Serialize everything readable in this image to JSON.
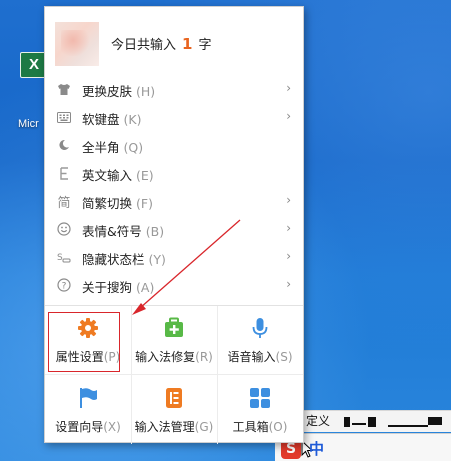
{
  "desktop": {
    "icon_label": "Micr",
    "status_text": "定义",
    "ime_logo": "S",
    "ime_mode": "中"
  },
  "menu": {
    "header": {
      "prefix": "今日共输入",
      "count": "1",
      "suffix": "字"
    },
    "items": [
      {
        "label": "更换皮肤",
        "hotkey": "(H)",
        "icon": "shirt-icon",
        "submenu": true
      },
      {
        "label": "软键盘",
        "hotkey": "(K)",
        "icon": "keyboard-icon",
        "submenu": true
      },
      {
        "label": "全半角",
        "hotkey": "(Q)",
        "icon": "moon-icon",
        "submenu": false
      },
      {
        "label": "英文输入",
        "hotkey": "(E)",
        "icon": "letter-e-icon",
        "submenu": false
      },
      {
        "label": "简繁切换",
        "hotkey": "(F)",
        "icon": "jian-icon",
        "submenu": true
      },
      {
        "label": "表情&符号",
        "hotkey": "(B)",
        "icon": "smiley-icon",
        "submenu": true
      },
      {
        "label": "隐藏状态栏",
        "hotkey": "(Y)",
        "icon": "statusbar-icon",
        "submenu": true
      },
      {
        "label": "关于搜狗",
        "hotkey": "(A)",
        "icon": "question-icon",
        "submenu": true
      }
    ],
    "tiles": [
      {
        "label": "属性设置",
        "hotkey": "(P)",
        "icon": "gear-icon",
        "selected": true
      },
      {
        "label": "输入法修复",
        "hotkey": "(R)",
        "icon": "repair-kit-icon",
        "selected": false
      },
      {
        "label": "语音输入",
        "hotkey": "(S)",
        "icon": "microphone-icon",
        "selected": false
      },
      {
        "label": "设置向导",
        "hotkey": "(X)",
        "icon": "flag-icon",
        "selected": false
      },
      {
        "label": "输入法管理",
        "hotkey": "(G)",
        "icon": "manager-icon",
        "selected": false
      },
      {
        "label": "工具箱",
        "hotkey": "(O)",
        "icon": "toolbox-icon",
        "selected": false
      }
    ]
  },
  "colors": {
    "accent_orange": "#e8641f",
    "annotation_red": "#d9262b",
    "tile_green": "#58b947",
    "tile_blue": "#3d8fe0"
  }
}
